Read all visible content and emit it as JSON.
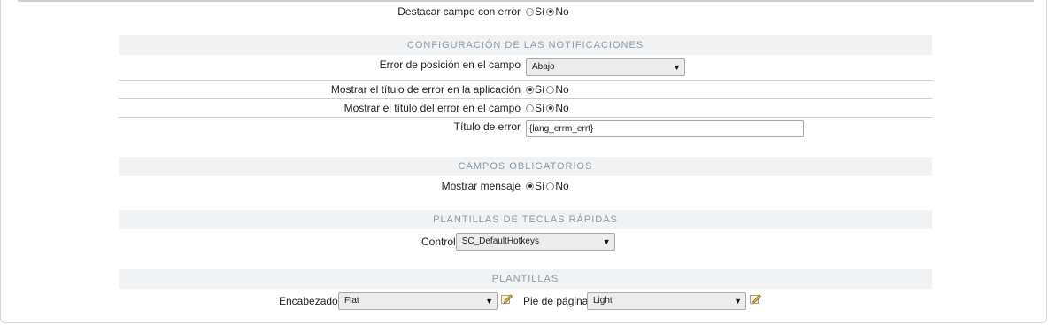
{
  "general": {
    "highlight_field": {
      "label": "Destacar campo con error",
      "yes": "Sí",
      "no": "No",
      "selected": "No"
    }
  },
  "notifications": {
    "title": "CONFIGURACIÓN DE LAS NOTIFICACIONES",
    "position": {
      "label": "Error de posición en el campo",
      "value": "Abajo"
    },
    "show_title_app": {
      "label": "Mostrar el título de error en la aplicación",
      "yes": "Sí",
      "no": "No",
      "selected": "Sí"
    },
    "show_title_field": {
      "label": "Mostrar el título del error en el campo",
      "yes": "Sí",
      "no": "No",
      "selected": "No"
    },
    "error_title": {
      "label": "Título de error",
      "value": "{lang_errm_errt}"
    }
  },
  "required": {
    "title": "CAMPOS OBLIGATORIOS",
    "show_message": {
      "label": "Mostrar mensaje",
      "yes": "Sí",
      "no": "No",
      "selected": "Sí"
    }
  },
  "hotkeys": {
    "title": "PLANTILLAS DE TECLAS RÁPIDAS",
    "control": {
      "label": "Control",
      "value": "SC_DefaultHotkeys"
    }
  },
  "templates": {
    "title": "PLANTILLAS",
    "header": {
      "label": "Encabezado",
      "value": "Flat"
    },
    "footer": {
      "label": "Pie de página",
      "value": "Light"
    }
  },
  "icons": {
    "dropdown": "caret-down-icon",
    "edit": "edit-pencil-icon"
  },
  "colors": {
    "section_bg": "#f0f2f4",
    "section_text": "#8a9aa8",
    "separator": "#cfcfcf"
  }
}
